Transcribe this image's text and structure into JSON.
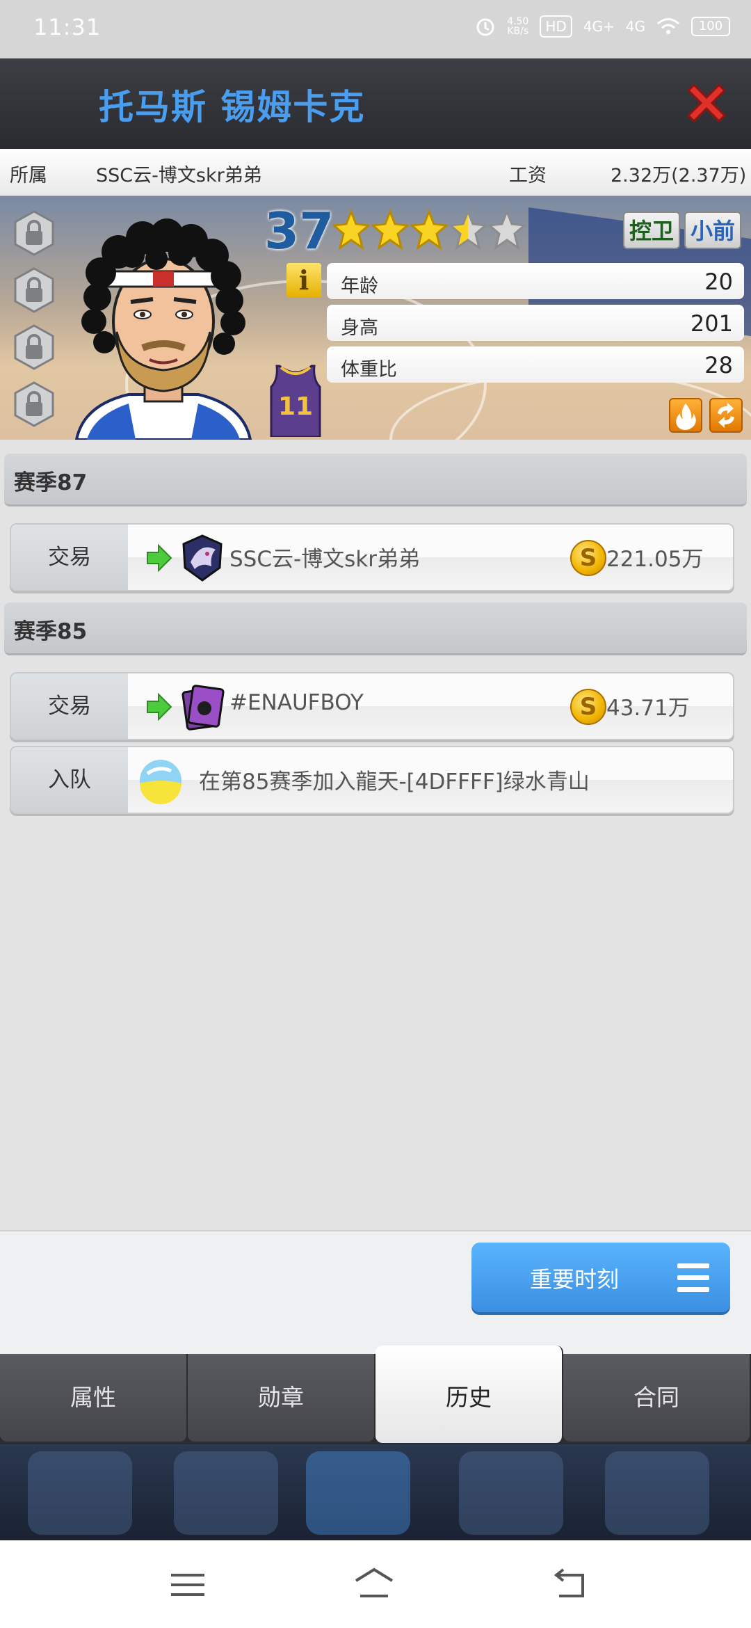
{
  "status_bar": {
    "time": "11:31",
    "net_speed_value": "4.50",
    "net_speed_unit": "KB/s",
    "hd": "HD",
    "sim1": "4G+",
    "sim2": "4G",
    "battery": "100"
  },
  "header": {
    "title": "托马斯 锡姆卡克",
    "close_icon": "close-x-icon"
  },
  "info": {
    "team_label": "所属",
    "team_value": "SSC云-博文skr弟弟",
    "salary_label": "工资",
    "salary_value": "2.32万(2.37万)"
  },
  "player": {
    "rating": "37",
    "stars": 3.5,
    "positions": [
      "控卫",
      "小前"
    ],
    "jersey_number": "11",
    "stats": [
      {
        "label": "年龄",
        "value": "20"
      },
      {
        "label": "身高",
        "value": "201"
      },
      {
        "label": "体重比",
        "value": "28"
      }
    ],
    "info_button": "i"
  },
  "history": {
    "seasons": [
      {
        "title": "赛季87",
        "entries": [
          {
            "type": "交易",
            "team": "SSC云-博文skr弟弟",
            "amount": "221.05万",
            "coin_symbol": "S"
          }
        ]
      },
      {
        "title": "赛季85",
        "entries": [
          {
            "type": "交易",
            "team": "#ENAUFBOY",
            "amount": "43.71万",
            "coin_symbol": "S"
          },
          {
            "type": "入队",
            "text": "在第85赛季加入龍天-[4DFFFF]绿水青山"
          }
        ]
      }
    ]
  },
  "moments_button": "重要时刻",
  "tabs": [
    {
      "label": "属性",
      "active": false
    },
    {
      "label": "勋章",
      "active": false
    },
    {
      "label": "历史",
      "active": true
    },
    {
      "label": "合同",
      "active": false
    }
  ],
  "colors": {
    "title_blue": "#4a9ef0",
    "accent_blue": "#3b8fe0",
    "coin_gold": "#f0b400",
    "arrow_green": "#3cc43c"
  }
}
